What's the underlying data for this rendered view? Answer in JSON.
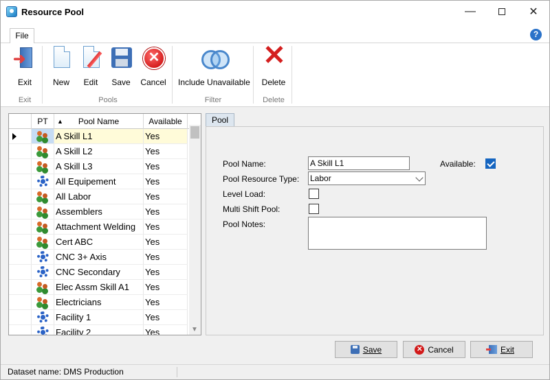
{
  "window": {
    "title": "Resource Pool"
  },
  "ribbon": {
    "tab_file": "File",
    "buttons": {
      "exit": "Exit",
      "new": "New",
      "edit": "Edit",
      "save": "Save",
      "cancel": "Cancel",
      "include_unavailable": "Include Unavailable",
      "delete": "Delete"
    },
    "groups": {
      "exit": "Exit",
      "pools": "Pools",
      "filter": "Filter",
      "delete": "Delete"
    }
  },
  "grid": {
    "headers": {
      "pt": "PT",
      "pool_name": "Pool Name",
      "available": "Available"
    },
    "rows": [
      {
        "icon": "people-icon",
        "name": "A Skill L1",
        "available": "Yes"
      },
      {
        "icon": "people-icon",
        "name": "A Skill L2",
        "available": "Yes"
      },
      {
        "icon": "people-icon",
        "name": "A Skill L3",
        "available": "Yes"
      },
      {
        "icon": "gear-icon",
        "name": "All Equipement",
        "available": "Yes"
      },
      {
        "icon": "people-icon",
        "name": "All Labor",
        "available": "Yes"
      },
      {
        "icon": "people-icon",
        "name": "Assemblers",
        "available": "Yes"
      },
      {
        "icon": "people-icon",
        "name": "Attachment Welding",
        "available": "Yes"
      },
      {
        "icon": "people-icon",
        "name": "Cert ABC",
        "available": "Yes"
      },
      {
        "icon": "gear-icon",
        "name": "CNC 3+ Axis",
        "available": "Yes"
      },
      {
        "icon": "gear-icon",
        "name": "CNC Secondary",
        "available": "Yes"
      },
      {
        "icon": "people-icon",
        "name": "Elec Assm Skill A1",
        "available": "Yes"
      },
      {
        "icon": "people-icon",
        "name": "Electricians",
        "available": "Yes"
      },
      {
        "icon": "gear-icon",
        "name": "Facility 1",
        "available": "Yes"
      },
      {
        "icon": "gear-icon",
        "name": "Facility 2",
        "available": "Yes"
      }
    ]
  },
  "detail": {
    "tab": "Pool",
    "pool_name_label": "Pool Name:",
    "pool_name_value": "A Skill L1",
    "available_label": "Available:",
    "resource_type_label": "Pool Resource Type:",
    "resource_type_value": "Labor",
    "level_load_label": "Level Load:",
    "multi_shift_label": "Multi Shift Pool:",
    "notes_label": "Pool Notes:"
  },
  "footer_buttons": {
    "save": "Save",
    "cancel": "Cancel",
    "exit": "Exit"
  },
  "status": {
    "dataset": "Dataset name:  DMS Production"
  }
}
